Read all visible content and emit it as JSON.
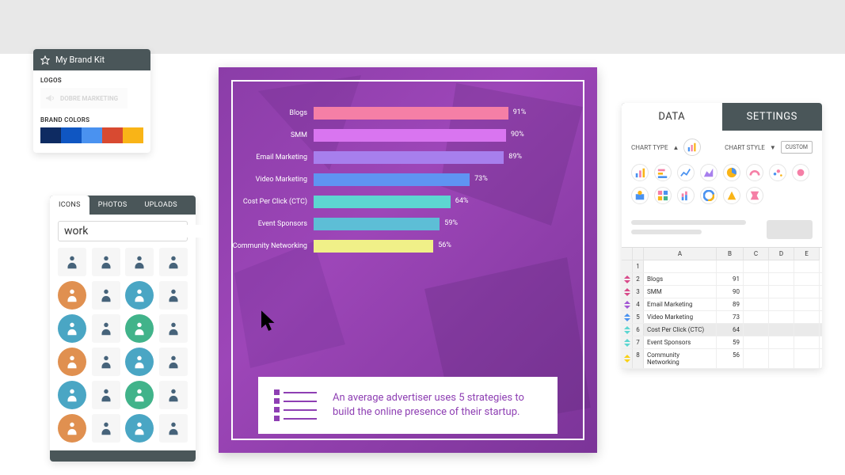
{
  "brand_kit": {
    "title": "My Brand Kit",
    "logos_label": "LOGOS",
    "logo_text": "DOBRE MARKETING",
    "colors_label": "BRAND COLORS",
    "colors": [
      "#0e2b62",
      "#0f56c2",
      "#4a92f0",
      "#d84a31",
      "#f9b417"
    ]
  },
  "icon_panel": {
    "tabs": {
      "icons": "ICONS",
      "photos": "PHOTOS",
      "uploads": "UPLOADS"
    },
    "search_value": "work"
  },
  "chart_data": {
    "type": "bar",
    "orientation": "horizontal",
    "categories": [
      "Blogs",
      "SMM",
      "Email Marketing",
      "Video Marketing",
      "Cost Per Click (CTC)",
      "Event Sponsors",
      "Community Networking"
    ],
    "values": [
      91,
      90,
      89,
      73,
      64,
      59,
      56
    ],
    "value_labels": [
      "91%",
      "90%",
      "89%",
      "73%",
      "64%",
      "59%",
      "56%"
    ],
    "bar_colors": [
      "#f57fa6",
      "#d975f0",
      "#a77fed",
      "#5f94f2",
      "#5dd6d1",
      "#5dbed6",
      "#f0f088"
    ],
    "xlim": [
      0,
      100
    ]
  },
  "callout_text": "An average advertiser uses 5 strategies to build the online presence of their startup.",
  "right_panel": {
    "tabs": {
      "data": "DATA",
      "settings": "SETTINGS"
    },
    "chart_type_label": "CHART TYPE",
    "chart_style_label": "CHART STYLE",
    "custom_label": "CUSTOM",
    "columns": [
      "A",
      "B",
      "C",
      "D",
      "E"
    ],
    "row_numbers": [
      "1",
      "2",
      "3",
      "4",
      "5",
      "6",
      "7",
      "8"
    ],
    "drag_colors": [
      "#d84a8a",
      "#d84a8a",
      "#a257d4",
      "#4a92f0",
      "#5dd6d1",
      "#5dd6d1",
      "#f9d117"
    ],
    "rows": [
      {
        "a": "",
        "b": ""
      },
      {
        "a": "Blogs",
        "b": "91"
      },
      {
        "a": "SMM",
        "b": "90"
      },
      {
        "a": "Email Marketing",
        "b": "89"
      },
      {
        "a": "Video Marketing",
        "b": "73"
      },
      {
        "a": "Cost Per Click (CTC)",
        "b": "64"
      },
      {
        "a": "Event Sponsors",
        "b": "59"
      },
      {
        "a": "Community Networking",
        "b": "56"
      }
    ]
  }
}
